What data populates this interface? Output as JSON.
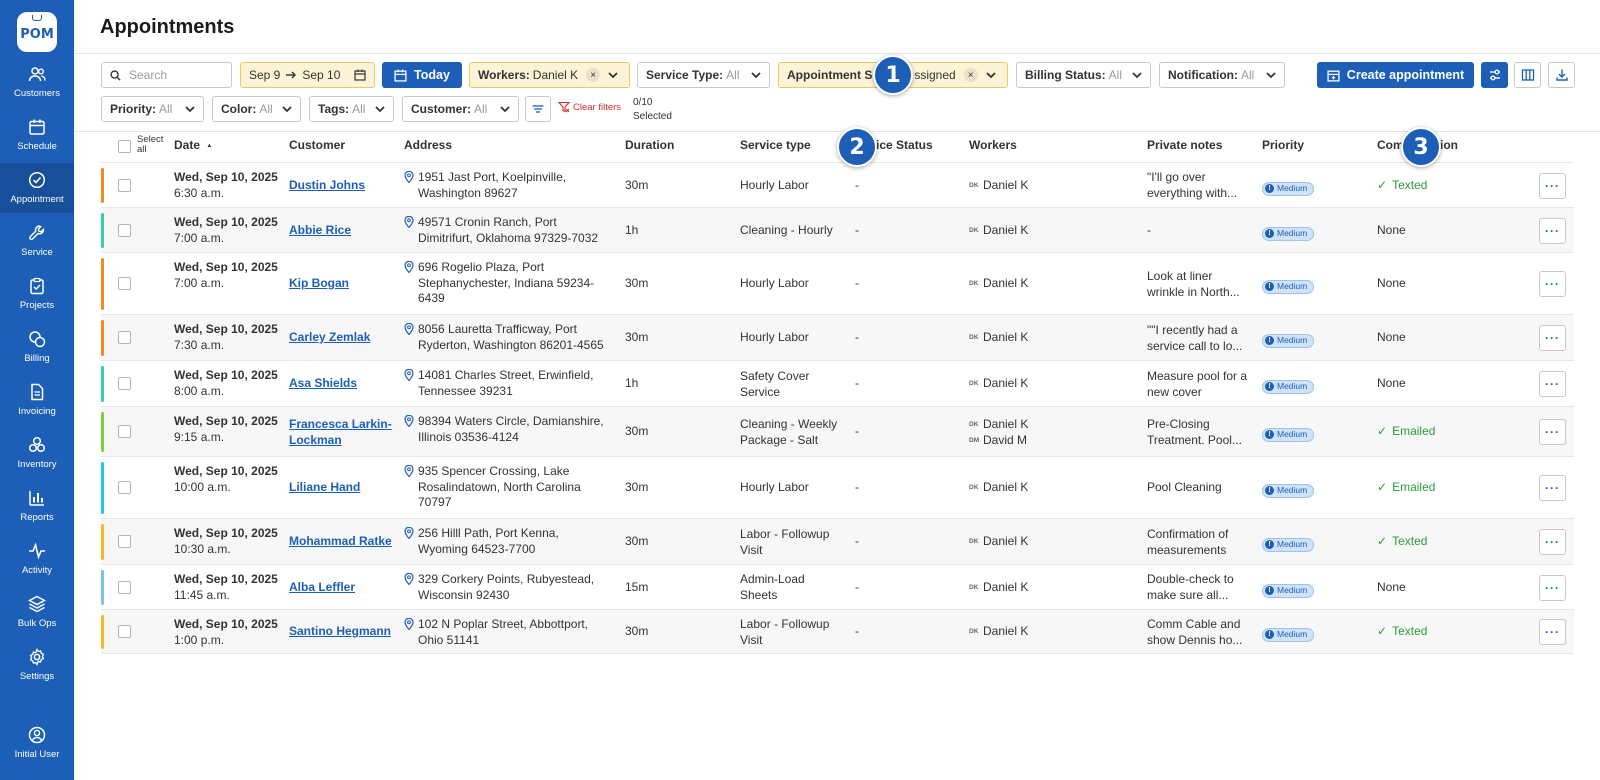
{
  "app": {
    "logo_text": "POM",
    "page_title": "Appointments"
  },
  "sidebar": {
    "items": [
      {
        "label": "Customers",
        "icon": "users-icon"
      },
      {
        "label": "Schedule",
        "icon": "calendar-icon"
      },
      {
        "label": "Appointment",
        "icon": "check-circle-icon",
        "active": true
      },
      {
        "label": "Service",
        "icon": "wrench-icon"
      },
      {
        "label": "Projects",
        "icon": "clipboard-check-icon"
      },
      {
        "label": "Billing",
        "icon": "coins-icon"
      },
      {
        "label": "Invoicing",
        "icon": "document-icon"
      },
      {
        "label": "Inventory",
        "icon": "boxes-icon"
      },
      {
        "label": "Reports",
        "icon": "bar-chart-icon"
      },
      {
        "label": "Activity",
        "icon": "pulse-icon"
      },
      {
        "label": "Bulk Ops",
        "icon": "layers-icon"
      },
      {
        "label": "Settings",
        "icon": "gear-icon"
      },
      {
        "label": "Initial User",
        "icon": "user-circle-icon"
      }
    ]
  },
  "filters": {
    "search_placeholder": "Search",
    "date_from": "Sep 9",
    "date_to": "Sep 10",
    "today_label": "Today",
    "workers": {
      "key": "Workers:",
      "value": "Daniel K"
    },
    "service_type": {
      "key": "Service Type:",
      "value": "All"
    },
    "appointment_status": {
      "key": "Appointment S",
      "value": "ssigned"
    },
    "billing_status": {
      "key": "Billing Status:",
      "value": "All"
    },
    "notification": {
      "key": "Notification:",
      "value": "All"
    },
    "priority": {
      "key": "Priority:",
      "value": "All"
    },
    "color": {
      "key": "Color:",
      "value": "All"
    },
    "tags": {
      "key": "Tags:",
      "value": "All"
    },
    "customer": {
      "key": "Customer:",
      "value": "All"
    },
    "clear_filters": "Clear filters",
    "selected_count": "0/10",
    "selected_label": "Selected",
    "chip_remove": "×"
  },
  "toolbar": {
    "create_label": "Create appointment"
  },
  "table": {
    "select_all": [
      "Select",
      "all"
    ],
    "sort_indicator": "▲",
    "headers": {
      "date": "Date",
      "customer": "Customer",
      "address": "Address",
      "duration": "Duration",
      "service_type": "Service type",
      "service_status": "ice Status",
      "workers": "Workers",
      "private_notes": "Private notes",
      "priority": "Priority",
      "communication_a": "Com",
      "communication_b": "tion"
    },
    "rows": [
      {
        "color": "#f5891f",
        "date": "Wed, Sep 10, 2025",
        "time": "6:30 a.m.",
        "customer": [
          "Dustin Johns"
        ],
        "address": [
          "1951 Jast Port, Koelpinville,",
          "Washington 89627"
        ],
        "duration": "30m",
        "service_type": [
          "Hourly Labor"
        ],
        "service_status": "-",
        "workers": [
          {
            "ini": "DK",
            "name": "Daniel K"
          }
        ],
        "notes": [
          "\"I'll go over",
          "everything with..."
        ],
        "priority": "Medium",
        "comm": "Texted",
        "comm_ok": true
      },
      {
        "color": "#2fd0b5",
        "date": "Wed, Sep 10, 2025",
        "time": "7:00 a.m.",
        "customer": [
          "Abbie Rice"
        ],
        "address": [
          "49571 Cronin Ranch, Port",
          "Dimitrifurt, Oklahoma 97329-7032"
        ],
        "duration": "1h",
        "service_type": [
          "Cleaning - Hourly"
        ],
        "service_status": "-",
        "workers": [
          {
            "ini": "DK",
            "name": "Daniel K"
          }
        ],
        "notes": [
          "-"
        ],
        "priority": "Medium",
        "comm": "None",
        "comm_ok": false
      },
      {
        "color": "#f5891f",
        "date": "Wed, Sep 10, 2025",
        "time": "7:00 a.m.",
        "customer": [
          "Kip Bogan"
        ],
        "address": [
          "696 Rogelio Plaza, Port",
          "Stephanychester, Indiana 59234-",
          "6439"
        ],
        "duration": "30m",
        "service_type": [
          "Hourly Labor"
        ],
        "service_status": "-",
        "workers": [
          {
            "ini": "DK",
            "name": "Daniel K"
          }
        ],
        "notes": [
          "Look at liner",
          "wrinkle in North..."
        ],
        "priority": "Medium",
        "comm": "None",
        "comm_ok": false
      },
      {
        "color": "#f5891f",
        "date": "Wed, Sep 10, 2025",
        "time": "7:30 a.m.",
        "customer": [
          "Carley Zemlak"
        ],
        "address": [
          "8056 Lauretta Trafficway, Port",
          "Ryderton, Washington 86201-4565"
        ],
        "duration": "30m",
        "service_type": [
          "Hourly Labor"
        ],
        "service_status": "-",
        "workers": [
          {
            "ini": "DK",
            "name": "Daniel K"
          }
        ],
        "notes": [
          "\"\"I recently had a",
          "service call to lo..."
        ],
        "priority": "Medium",
        "comm": "None",
        "comm_ok": false
      },
      {
        "color": "#2fd0b5",
        "date": "Wed, Sep 10, 2025",
        "time": "8:00 a.m.",
        "customer": [
          "Asa Shields"
        ],
        "address": [
          "14081 Charles Street, Erwinfield,",
          "Tennessee 39231"
        ],
        "duration": "1h",
        "service_type": [
          "Safety Cover",
          "Service"
        ],
        "service_status": "-",
        "workers": [
          {
            "ini": "DK",
            "name": "Daniel K"
          }
        ],
        "notes": [
          "Measure pool for a",
          "new cover"
        ],
        "priority": "Medium",
        "comm": "None",
        "comm_ok": false
      },
      {
        "color": "#7ad33a",
        "date": "Wed, Sep 10, 2025",
        "time": "9:15 a.m.",
        "customer": [
          "Francesca Larkin-",
          "Lockman"
        ],
        "address": [
          "98394 Waters Circle, Damianshire,",
          "Illinois 03536-4124"
        ],
        "duration": "30m",
        "service_type": [
          "Cleaning - Weekly",
          "Package - Salt"
        ],
        "service_status": "-",
        "workers": [
          {
            "ini": "DK",
            "name": "Daniel K"
          },
          {
            "ini": "DM",
            "name": "David M"
          }
        ],
        "notes": [
          "Pre-Closing",
          "Treatment. Pool..."
        ],
        "priority": "Medium",
        "comm": "Emailed",
        "comm_ok": true
      },
      {
        "color": "#22c6e6",
        "date": "Wed, Sep 10, 2025",
        "time": "10:00 a.m.",
        "customer": [
          "Liliane Hand"
        ],
        "address": [
          "935 Spencer Crossing, Lake",
          "Rosalindatown, North Carolina",
          "70797"
        ],
        "duration": "30m",
        "service_type": [
          "Hourly Labor"
        ],
        "service_status": "-",
        "workers": [
          {
            "ini": "DK",
            "name": "Daniel K"
          }
        ],
        "notes": [
          "Pool Cleaning"
        ],
        "priority": "Medium",
        "comm": "Emailed",
        "comm_ok": true
      },
      {
        "color": "#f5b82a",
        "date": "Wed, Sep 10, 2025",
        "time": "10:30 a.m.",
        "customer": [
          "Mohammad Ratke"
        ],
        "address": [
          "256 Hilll Path, Port Kenna,",
          "Wyoming 64523-7700"
        ],
        "duration": "30m",
        "service_type": [
          "Labor - Followup",
          "Visit"
        ],
        "service_status": "-",
        "workers": [
          {
            "ini": "DK",
            "name": "Daniel K"
          }
        ],
        "notes": [
          "Confirmation of",
          "measurements"
        ],
        "priority": "Medium",
        "comm": "Texted",
        "comm_ok": true
      },
      {
        "color": "#7cc0ee",
        "date": "Wed, Sep 10, 2025",
        "time": "11:45 a.m.",
        "customer": [
          "Alba Leffler"
        ],
        "address": [
          "329 Corkery Points, Rubyestead,",
          "Wisconsin 92430"
        ],
        "duration": "15m",
        "service_type": [
          "Admin-Load",
          "Sheets"
        ],
        "service_status": "-",
        "workers": [
          {
            "ini": "DK",
            "name": "Daniel K"
          }
        ],
        "notes": [
          "Double-check to",
          "make sure all..."
        ],
        "priority": "Medium",
        "comm": "None",
        "comm_ok": false
      },
      {
        "color": "#f5b82a",
        "date": "Wed, Sep 10, 2025",
        "time": "1:00 p.m.",
        "customer": [
          "Santino Hegmann"
        ],
        "address": [
          "102 N Poplar Street, Abbottport,",
          "Ohio 51141"
        ],
        "duration": "30m",
        "service_type": [
          "Labor - Followup",
          "Visit"
        ],
        "service_status": "-",
        "workers": [
          {
            "ini": "DK",
            "name": "Daniel K"
          }
        ],
        "notes": [
          "Comm Cable and",
          "show Dennis ho..."
        ],
        "priority": "Medium",
        "comm": "Texted",
        "comm_ok": true
      }
    ],
    "more_label": "···",
    "check_glyph": "✓",
    "priority_glyph": "!"
  },
  "markers": [
    "1",
    "2",
    "3"
  ],
  "colors": {
    "brand": "#1d5fb6",
    "filter_active_bg": "#fdf3d6",
    "success": "#2e9b3b",
    "danger": "#d0302f"
  }
}
